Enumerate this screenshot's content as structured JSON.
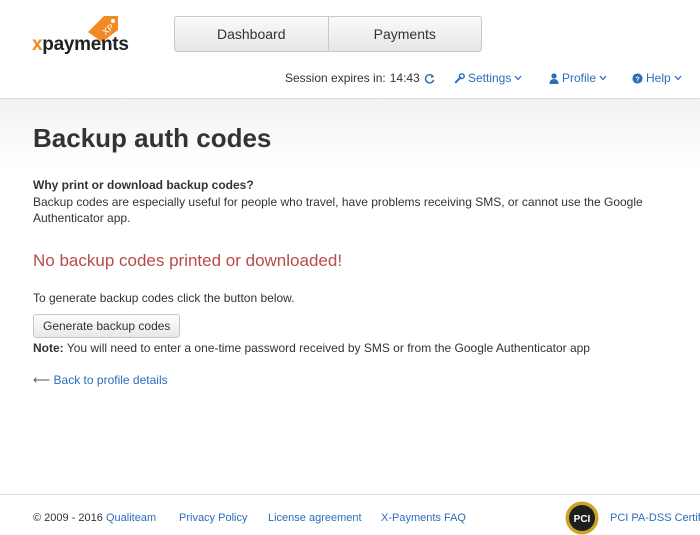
{
  "logo": {
    "prefix": "x",
    "name": "payments",
    "tag": "XP"
  },
  "nav": {
    "dashboard": "Dashboard",
    "payments": "Payments"
  },
  "session": {
    "label": "Session expires in:",
    "time": "14:43"
  },
  "menu": {
    "settings": "Settings",
    "profile": "Profile",
    "help": "Help"
  },
  "page": {
    "title": "Backup auth codes",
    "why_title": "Why print or download backup codes?",
    "why_text": "Backup codes are especially useful for people who travel, have problems receiving SMS, or cannot use the Google Authenticator app.",
    "warning": "No backup codes printed or downloaded!",
    "generate_text": "To generate backup codes click the button below.",
    "generate_button": "Generate backup codes",
    "note_label": "Note:",
    "note_text": " You will need to enter a one-time password received by SMS or from the Google Authenticator app",
    "back_arrow": "⟵",
    "back_link": "Back to profile details"
  },
  "footer": {
    "copyright": "© 2009 - 2016",
    "qualiteam": "Qualiteam",
    "privacy": "Privacy Policy",
    "license": "License agreement",
    "faq": "X-Payments FAQ",
    "pci_badge": "PCI",
    "pci_text": "PCI PA-DSS Certified"
  },
  "colors": {
    "brand_orange": "#f08a24",
    "link": "#2a6ebb",
    "warning": "#b94a48"
  },
  "icons": [
    "refresh-icon",
    "wrench-icon",
    "user-icon",
    "help-circle-icon",
    "chevron-down-icon",
    "pci-badge-icon"
  ]
}
